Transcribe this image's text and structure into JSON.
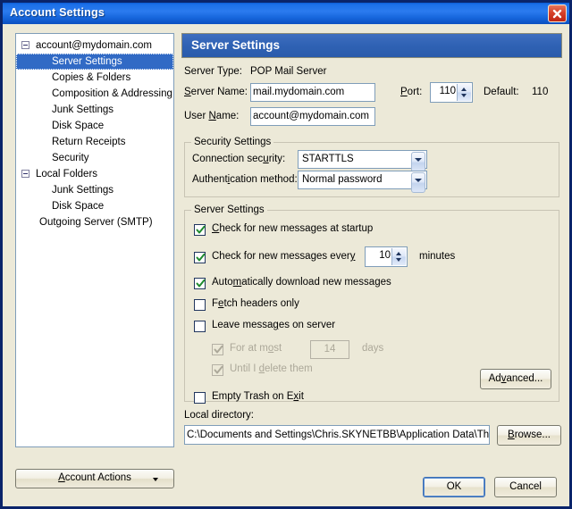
{
  "window": {
    "title": "Account Settings",
    "close_icon": "close-icon"
  },
  "sidebar": {
    "items": [
      {
        "label": "account@mydomain.com",
        "level": "root",
        "expanded": true,
        "selected": false
      },
      {
        "label": "Server Settings",
        "level": "child",
        "selected": true
      },
      {
        "label": "Copies & Folders",
        "level": "child",
        "selected": false
      },
      {
        "label": "Composition & Addressing",
        "level": "child",
        "selected": false
      },
      {
        "label": "Junk Settings",
        "level": "child",
        "selected": false
      },
      {
        "label": "Disk Space",
        "level": "child",
        "selected": false
      },
      {
        "label": "Return Receipts",
        "level": "child",
        "selected": false
      },
      {
        "label": "Security",
        "level": "child",
        "selected": false
      },
      {
        "label": "Local Folders",
        "level": "root",
        "expanded": true,
        "selected": false
      },
      {
        "label": "Junk Settings",
        "level": "child",
        "selected": false
      },
      {
        "label": "Disk Space",
        "level": "child",
        "selected": false
      },
      {
        "label": "Outgoing Server (SMTP)",
        "level": "smtp",
        "selected": false
      }
    ],
    "account_actions": {
      "label_pre": "",
      "accel": "A",
      "label_post": "ccount Actions"
    }
  },
  "pane": {
    "header": "Server Settings",
    "server_type_label": "Server Type:",
    "server_type_value": "POP Mail Server",
    "server_name_label_accel": "S",
    "server_name_label_rest": "erver Name:",
    "server_name_value": "mail.mydomain.com",
    "port_label_accel": "P",
    "port_label_rest": "ort:",
    "port_value": "110",
    "default_label": "Default:",
    "default_value": "110",
    "user_name_label_pre": "User ",
    "user_name_label_accel": "N",
    "user_name_label_rest": "ame:",
    "user_name_value": "account@mydomain.com"
  },
  "security": {
    "caption": "Security Settings",
    "connection_label_pre": "Connection sec",
    "connection_label_accel": "u",
    "connection_label_rest": "rity:",
    "connection_value": "STARTTLS",
    "auth_label_pre": "Authent",
    "auth_label_accel": "i",
    "auth_label_rest": "cation method:",
    "auth_value": "Normal password"
  },
  "server_settings": {
    "caption": "Server Settings",
    "startup": {
      "pre": "",
      "accel": "C",
      "post": "heck for new messages at startup",
      "checked": true,
      "enabled": true
    },
    "every": {
      "pre": "Check for new messages ever",
      "accel": "y",
      "post": "",
      "checked": true,
      "enabled": true
    },
    "interval_value": "10",
    "minutes_label": "minutes",
    "autodownload": {
      "pre": "Auto",
      "accel": "m",
      "post": "atically download new messages",
      "checked": true,
      "enabled": true
    },
    "fetch_headers": {
      "pre": "F",
      "accel": "e",
      "post": "tch headers only",
      "checked": false,
      "enabled": true
    },
    "leave_messages": {
      "pre": "Leave messa",
      "accel": "g",
      "post": "es on server",
      "checked": false,
      "enabled": true
    },
    "for_at_most": {
      "pre": "For at m",
      "accel": "o",
      "post": "st",
      "checked": true,
      "enabled": false
    },
    "days_value": "14",
    "days_label": "days",
    "until_delete": {
      "pre": "Until I ",
      "accel": "d",
      "post": "elete them",
      "checked": true,
      "enabled": false
    },
    "empty_trash": {
      "pre": "Empty Trash on E",
      "accel": "x",
      "post": "it",
      "checked": false,
      "enabled": true
    },
    "advanced_button": {
      "pre": "Ad",
      "accel": "v",
      "post": "anced..."
    }
  },
  "local_directory": {
    "label": "Local directory:",
    "value": "C:\\Documents and Settings\\Chris.SKYNETBB\\Application Data\\Thunde",
    "browse_button": {
      "pre": "",
      "accel": "B",
      "post": "rowse..."
    }
  },
  "footer": {
    "ok": "OK",
    "cancel": "Cancel"
  },
  "colors": {
    "titlebar_blue": "#1B6FE8",
    "dialog_bg": "#ECE9D8",
    "selection_blue": "#316AC5",
    "pane_header_blue": "#2F62B4",
    "check_green": "#1E8A2E",
    "field_border": "#7F9DB9"
  }
}
